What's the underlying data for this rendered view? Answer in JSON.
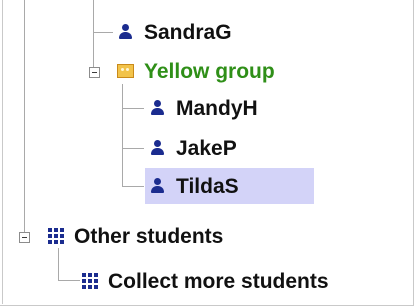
{
  "tree": {
    "nodes": [
      {
        "id": "sandrag",
        "label": "SandraG",
        "icon": "person-icon"
      },
      {
        "id": "yellow-group",
        "label": "Yellow group",
        "icon": "group-icon",
        "color": "#2f8f18",
        "expanded": true
      },
      {
        "id": "mandyh",
        "label": "MandyH",
        "icon": "person-icon"
      },
      {
        "id": "jakep",
        "label": "JakeP",
        "icon": "person-icon"
      },
      {
        "id": "tildas",
        "label": "TildaS",
        "icon": "person-icon",
        "selected": true
      },
      {
        "id": "other-students",
        "label": "Other students",
        "icon": "grid-icon",
        "expanded": true
      },
      {
        "id": "collect-more-students",
        "label": "Collect more students",
        "icon": "grid-icon"
      }
    ]
  },
  "colors": {
    "selection": "#d3d3f8",
    "icon_blue": "#1b2c8f",
    "group_label": "#2f8f18"
  }
}
